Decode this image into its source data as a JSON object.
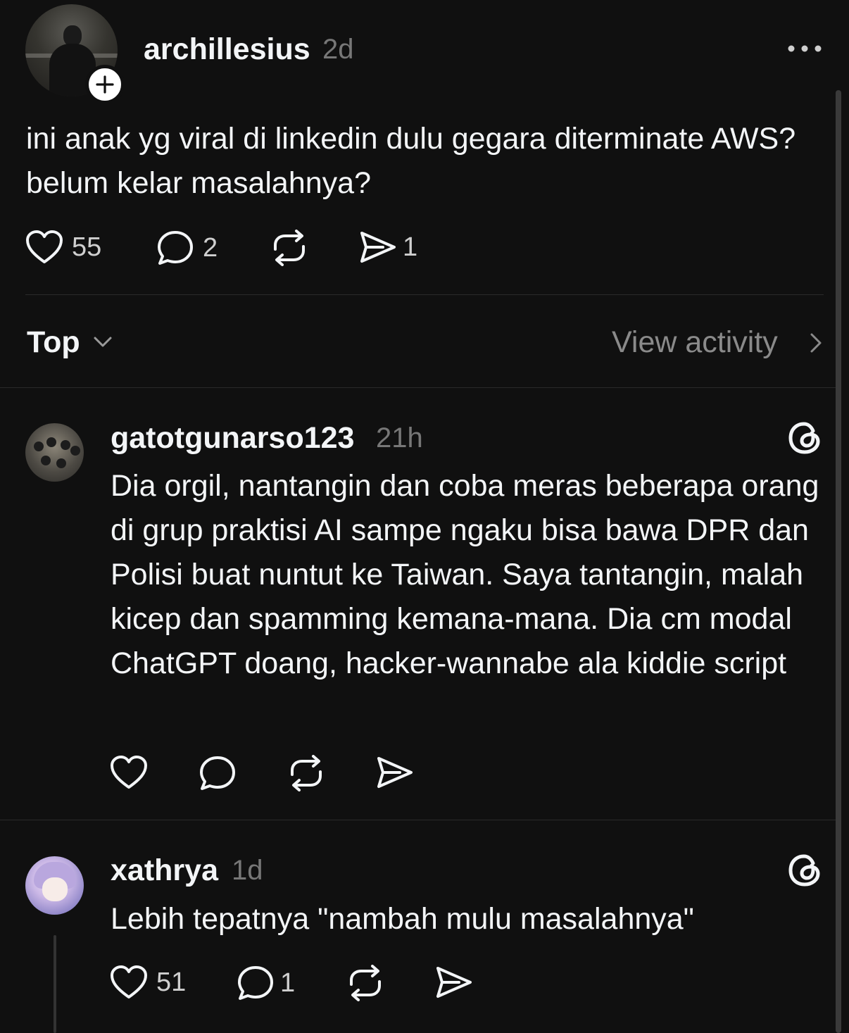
{
  "post": {
    "username": "archillesius",
    "time": "2d",
    "text": "ini anak yg viral di linkedin dulu gegara diterminate AWS? belum kelar masalahnya?",
    "likes": "55",
    "replies": "2",
    "shares": "1"
  },
  "sort": {
    "label": "Top"
  },
  "activity": {
    "label": "View activity"
  },
  "comments": [
    {
      "username": "gatotgunarso123",
      "time": "21h",
      "text": "Dia orgil, nantangin dan coba meras beberapa orang di grup praktisi AI sampe ngaku bisa bawa DPR dan Polisi buat nuntut ke Taiwan. Saya tantangin, malah kicep dan spamming kemana-mana. Dia cm modal ChatGPT doang, hacker-wannabe ala kiddie script"
    },
    {
      "username": "xathrya",
      "time": "1d",
      "text": "Lebih tepatnya \"nambah mulu masalahnya\"",
      "likes": "51",
      "replies": "1"
    }
  ],
  "icons": {
    "like": "heart-icon",
    "reply": "comment-bubble-icon",
    "repost": "repost-icon",
    "share": "send-icon",
    "more": "more-dots-icon",
    "threads": "threads-logo-icon",
    "follow": "plus-icon"
  },
  "colors": {
    "background": "#101010",
    "text": "#f3f5f7",
    "muted": "#777777",
    "divider": "#2a2a2a"
  }
}
